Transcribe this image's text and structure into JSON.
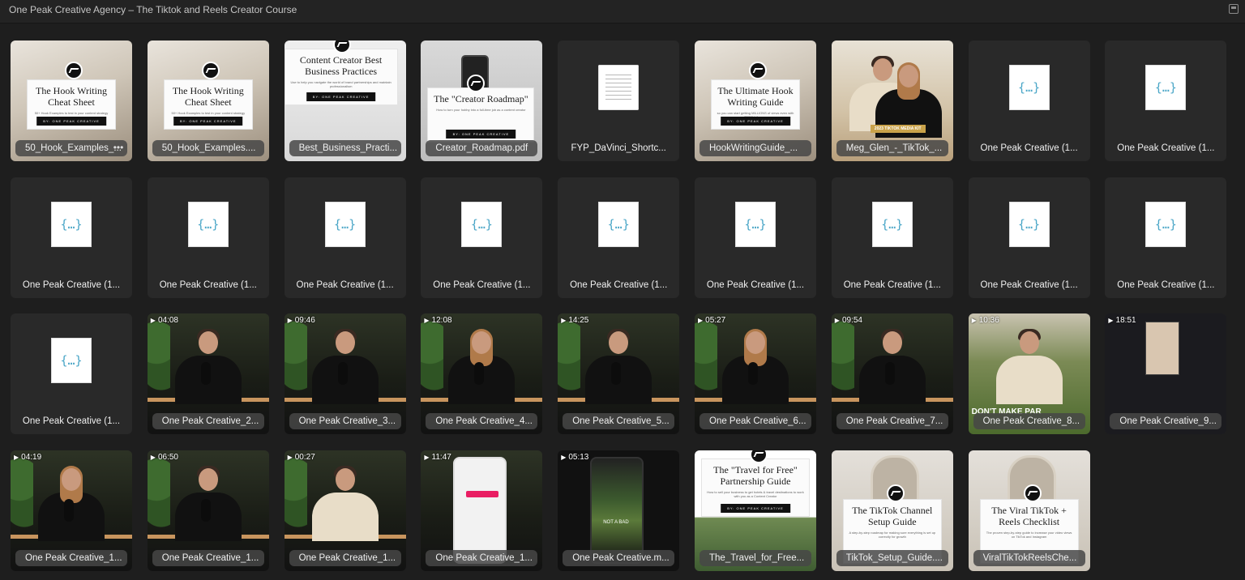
{
  "window": {
    "title": "One Peak Creative Agency – The Tiktok and Reels Creator Course"
  },
  "items": [
    {
      "label": "50_Hook_Examples_...",
      "kind": "card",
      "bg": "desk",
      "heading": "The Hook Writing Cheat Sheet",
      "sub": "50+ Hook Examples to test in your content strategy",
      "by": "BY: ONE PEAK CREATIVE",
      "selected": true,
      "more": true
    },
    {
      "label": "50_Hook_Examples....",
      "kind": "card",
      "bg": "desk",
      "heading": "The Hook Writing Cheat Sheet",
      "sub": "50+ Hook Examples to test in your content strategy",
      "by": "BY: ONE PEAK CREATIVE"
    },
    {
      "label": "Best_Business_Practi...",
      "kind": "card2",
      "bg": "clean",
      "heading": "Content Creator Best Business Practices",
      "sub": "Use to help you navigate the world of brand partnerships and maintain professionalism",
      "by": "BY: ONE PEAK CREATIVE"
    },
    {
      "label": "Creator_Roadmap.pdf",
      "kind": "card3",
      "bg": "phone",
      "heading": "The \"Creator Roadmap\"",
      "sub": "How to turn your hobby into a full-time job as a content creator",
      "by": "BY: ONE PEAK CREATIVE"
    },
    {
      "label": "FYP_DaVinci_Shortc...",
      "kind": "doc",
      "bg": "none"
    },
    {
      "label": "HookWritingGuide_...",
      "kind": "card",
      "bg": "desk",
      "heading": "The Ultimate Hook Writing Guide",
      "sub": "so you can start getting MILLIONS of views even with ZERO followers",
      "by": "BY: ONE PEAK CREATIVE"
    },
    {
      "label": "Meg_Glen_-_TikTok_...",
      "kind": "beach",
      "bg": "beach",
      "badge": "2023 TIKTOK MEDIA KIT"
    },
    {
      "label": "One Peak Creative (1...",
      "kind": "json"
    },
    {
      "label": "One Peak Creative (1...",
      "kind": "json"
    },
    {
      "label": "One Peak Creative (1...",
      "kind": "json"
    },
    {
      "label": "One Peak Creative (1...",
      "kind": "json"
    },
    {
      "label": "One Peak Creative (1...",
      "kind": "json"
    },
    {
      "label": "One Peak Creative (1...",
      "kind": "json"
    },
    {
      "label": "One Peak Creative (1...",
      "kind": "json"
    },
    {
      "label": "One Peak Creative (1...",
      "kind": "json"
    },
    {
      "label": "One Peak Creative (1...",
      "kind": "json"
    },
    {
      "label": "One Peak Creative (1...",
      "kind": "json"
    },
    {
      "label": "One Peak Creative (1...",
      "kind": "json"
    },
    {
      "label": "One Peak Creative (1...",
      "kind": "json"
    },
    {
      "label": "One Peak Creative_2...",
      "kind": "video",
      "duration": "04:08",
      "person": "man"
    },
    {
      "label": "One Peak Creative_3...",
      "kind": "video",
      "duration": "09:46",
      "person": "man"
    },
    {
      "label": "One Peak Creative_4...",
      "kind": "video",
      "duration": "12:08",
      "person": "woman"
    },
    {
      "label": "One Peak Creative_5...",
      "kind": "video",
      "duration": "14:25",
      "person": "man"
    },
    {
      "label": "One Peak Creative_6...",
      "kind": "video",
      "duration": "05:27",
      "person": "woman"
    },
    {
      "label": "One Peak Creative_7...",
      "kind": "video",
      "duration": "09:54",
      "person": "man"
    },
    {
      "label": "One Peak Creative_8...",
      "kind": "golf",
      "duration": "10:36",
      "overlay": "DON'T MAKE PAR"
    },
    {
      "label": "One Peak Creative_9...",
      "kind": "app",
      "duration": "18:51"
    },
    {
      "label": "One Peak Creative_1...",
      "kind": "video",
      "duration": "04:19",
      "person": "woman"
    },
    {
      "label": "One Peak Creative_1...",
      "kind": "video",
      "duration": "06:50",
      "person": "man"
    },
    {
      "label": "One Peak Creative_1...",
      "kind": "video",
      "duration": "00:27",
      "person": "man-light"
    },
    {
      "label": "One Peak Creative_1...",
      "kind": "phone-light",
      "duration": "11:47"
    },
    {
      "label": "One Peak Creative.m...",
      "kind": "phone-dark",
      "duration": "05:13",
      "overlay": "NOT A BAD"
    },
    {
      "label": "The_Travel_for_Free...",
      "kind": "card4",
      "bg": "palm",
      "heading": "The \"Travel for Free\" Partnership Guide",
      "sub": "How to sell your business to get hotels & travel destinations to work with you as a Content Creator",
      "by": "BY: ONE PEAK CREATIVE"
    },
    {
      "label": "TikTok_Setup_Guide....",
      "kind": "card5",
      "bg": "mirror",
      "heading": "The TikTok Channel Setup Guide",
      "sub": "A step-by-step roadmap for making sure everything is set up correctly for growth"
    },
    {
      "label": "ViralTikTokReelsChe...",
      "kind": "card5",
      "bg": "mirror",
      "heading": "The Viral TikTok + Reels Checklist",
      "sub": "The proven step-by-step guide to increase your video views on TikTok and Instagram"
    }
  ]
}
